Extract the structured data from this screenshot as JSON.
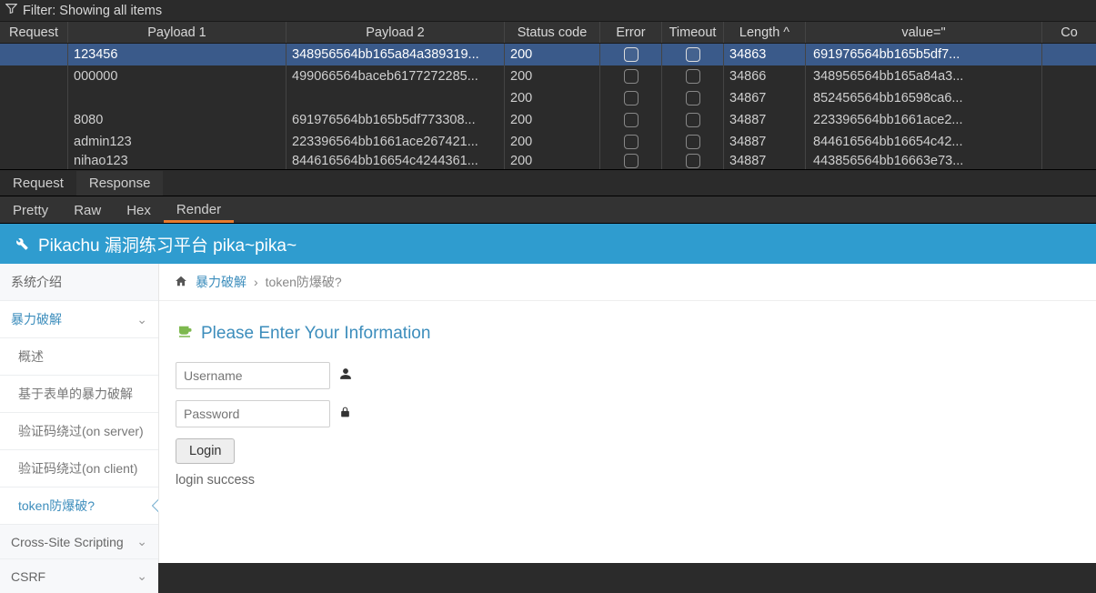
{
  "filter_text": "Filter: Showing all items",
  "columns": {
    "request": "Request",
    "p1": "Payload 1",
    "p2": "Payload 2",
    "status": "Status code",
    "error": "Error",
    "timeout": "Timeout",
    "length": "Length ^",
    "value": "value=\"",
    "co": "Co"
  },
  "rows": [
    {
      "sel": true,
      "req": "",
      "p1": "123456",
      "p2": "348956564bb165a84a389319...",
      "sc": "200",
      "len": "34863",
      "val": "691976564bb165b5df7..."
    },
    {
      "sel": false,
      "req": "",
      "p1": "000000",
      "p2": "499066564baceb6177272285...",
      "sc": "200",
      "len": "34866",
      "val": "348956564bb165a84a3..."
    },
    {
      "sel": false,
      "req": "",
      "p1": "",
      "p2": "",
      "sc": "200",
      "len": "34867",
      "val": "852456564bb16598ca6..."
    },
    {
      "sel": false,
      "req": "",
      "p1": "8080",
      "p2": "691976564bb165b5df773308...",
      "sc": "200",
      "len": "34887",
      "val": "223396564bb1661ace2..."
    },
    {
      "sel": false,
      "req": "",
      "p1": "admin123",
      "p2": "223396564bb1661ace267421...",
      "sc": "200",
      "len": "34887",
      "val": "844616564bb16654c42..."
    },
    {
      "sel": false,
      "req": "",
      "p1": "nihao123",
      "p2": "844616564bb16654c4244361...",
      "sc": "200",
      "len": "34887",
      "val": "443856564bb16663e73..."
    }
  ],
  "rr_tabs": {
    "request": "Request",
    "response": "Response"
  },
  "view_tabs": {
    "pretty": "Pretty",
    "raw": "Raw",
    "hex": "Hex",
    "render": "Render"
  },
  "pika": {
    "header": "Pikachu 漏洞练习平台 pika~pika~",
    "aside": {
      "intro": "系统介绍",
      "brute": "暴力破解",
      "subs": {
        "overview": "概述",
        "form": "基于表单的暴力破解",
        "server": "验证码绕过(on server)",
        "client": "验证码绕过(on client)",
        "token": "token防爆破?"
      },
      "xss": "Cross-Site Scripting",
      "csrf": "CSRF"
    },
    "breadcrumb": {
      "link": "暴力破解",
      "current": "token防爆破?"
    },
    "form": {
      "title": "Please Enter Your Information",
      "username_ph": "Username",
      "password_ph": "Password",
      "login": "Login",
      "msg": "login success"
    }
  }
}
